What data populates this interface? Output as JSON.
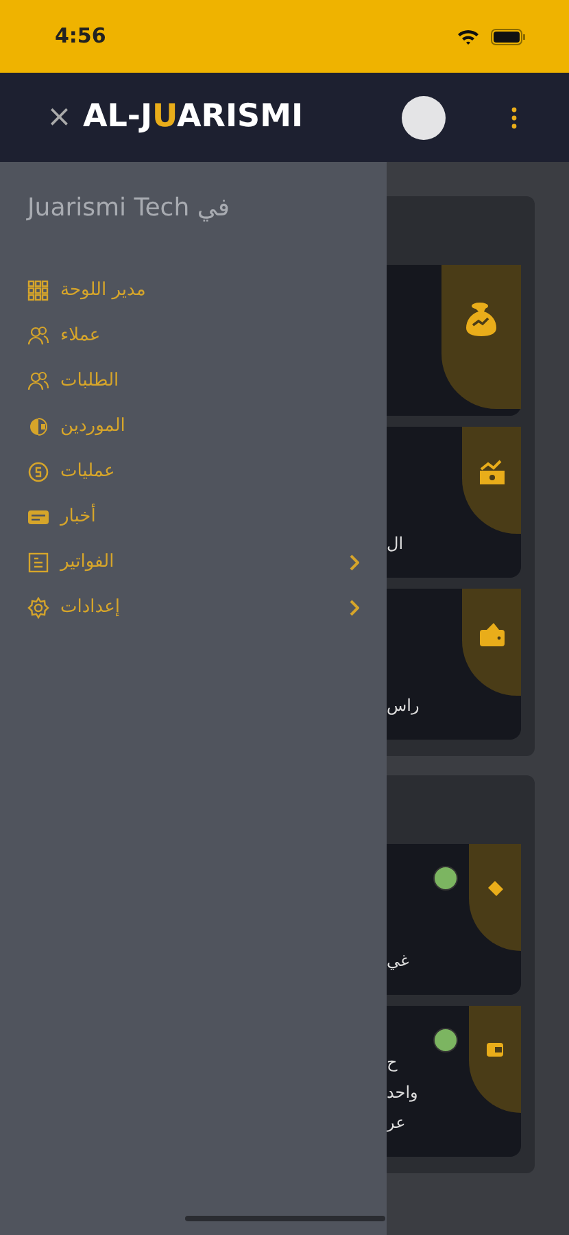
{
  "status_bar": {
    "time": "4:56"
  },
  "header": {
    "close": "×",
    "logo": {
      "start": "AL-J",
      "accent_letter": "U",
      "end": "ARISMI"
    }
  },
  "drawer": {
    "title": "Juarismi Tech في",
    "items": [
      {
        "label": "مدير اللوحة",
        "expandable": false
      },
      {
        "label": "عملاء",
        "expandable": false
      },
      {
        "label": "الطلبات",
        "expandable": false
      },
      {
        "label": "الموردين",
        "expandable": false
      },
      {
        "label": "عمليات",
        "expandable": false
      },
      {
        "label": "أخبار",
        "expandable": false
      },
      {
        "label": "الفواتير",
        "expandable": true
      },
      {
        "label": "إعدادات",
        "expandable": true
      }
    ]
  },
  "summary_cards": [
    {
      "kind": "featured"
    },
    {
      "kind": "regular",
      "texts": [
        "ال"
      ]
    },
    {
      "kind": "regular",
      "texts": [
        "راس"
      ]
    }
  ],
  "status_cards": [
    {
      "texts": [
        "غي"
      ],
      "color": "#7cb561"
    },
    {
      "texts": [
        "ح",
        "واحد",
        "عر"
      ],
      "color": "#7cb561"
    }
  ]
}
